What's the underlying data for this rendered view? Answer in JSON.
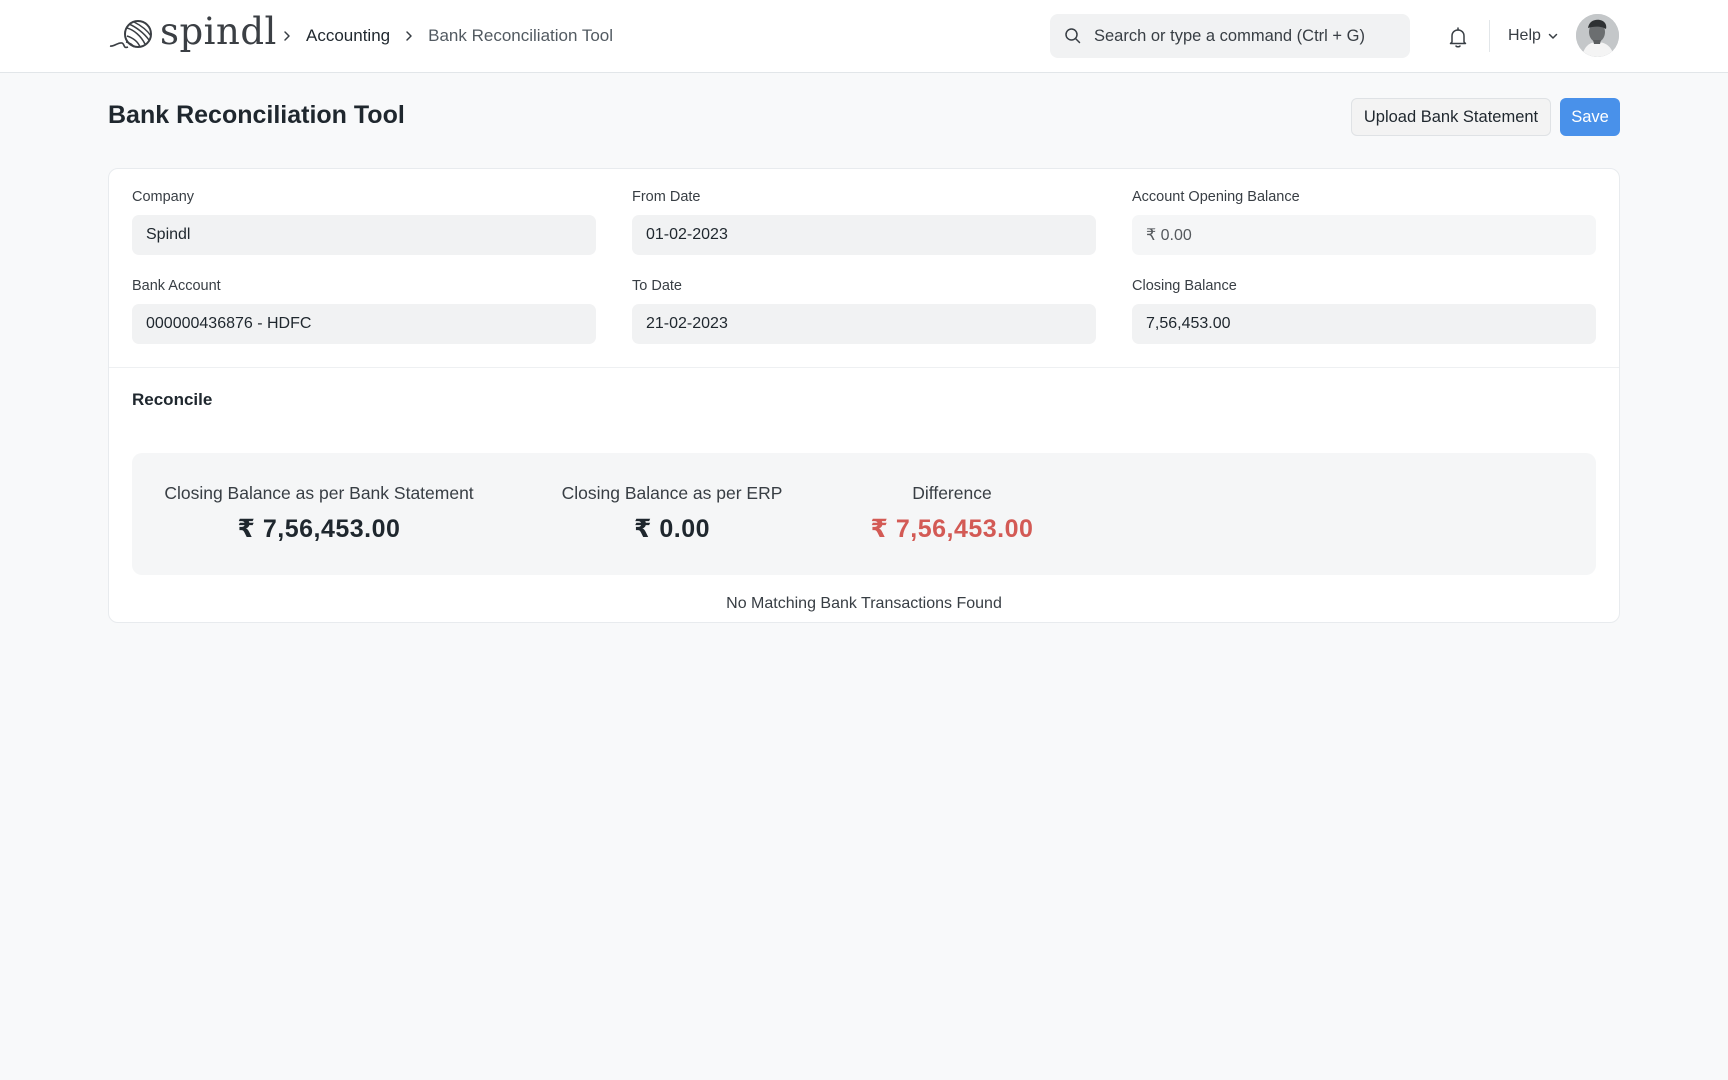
{
  "navbar": {
    "brand": "spindl",
    "breadcrumbs": [
      "Accounting",
      "Bank Reconciliation Tool"
    ],
    "search_placeholder": "Search or type a command (Ctrl + G)",
    "help_label": "Help"
  },
  "page": {
    "title": "Bank Reconciliation Tool",
    "upload_label": "Upload Bank Statement",
    "save_label": "Save"
  },
  "form": {
    "company": {
      "label": "Company",
      "value": "Spindl"
    },
    "from_date": {
      "label": "From Date",
      "value": "01-02-2023"
    },
    "opening_balance": {
      "label": "Account Opening Balance",
      "value": "₹ 0.00"
    },
    "bank_account": {
      "label": "Bank Account",
      "value": "000000436876 - HDFC"
    },
    "to_date": {
      "label": "To Date",
      "value": "21-02-2023"
    },
    "closing_balance": {
      "label": "Closing Balance",
      "value": "7,56,453.00"
    }
  },
  "reconcile": {
    "title": "Reconcile",
    "stats": [
      {
        "label": "Closing Balance as per Bank Statement",
        "value": "₹ 7,56,453.00"
      },
      {
        "label": "Closing Balance as per ERP",
        "value": "₹ 0.00"
      },
      {
        "label": "Difference",
        "value": "₹ 7,56,453.00"
      }
    ],
    "empty_message": "No Matching Bank Transactions Found"
  },
  "colors": {
    "primary": "#4991ea",
    "negative": "#d35a55"
  }
}
